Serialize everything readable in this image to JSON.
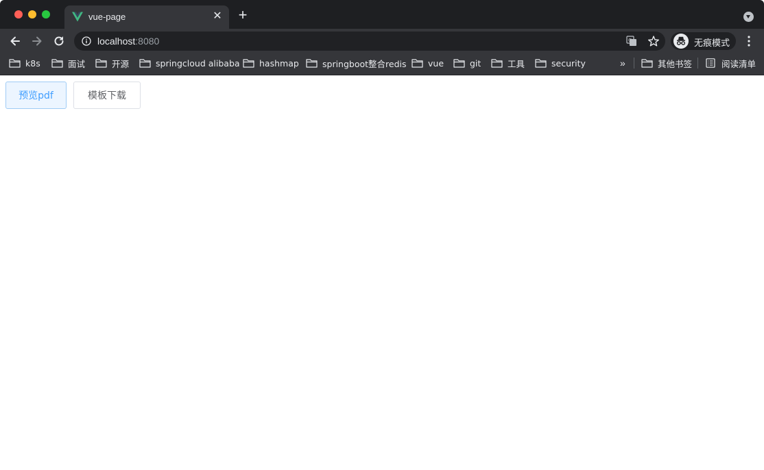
{
  "browser": {
    "tab": {
      "title": "vue-page",
      "favicon": "vue-logo-icon"
    },
    "address": {
      "host": "localhost",
      "port": ":8080"
    },
    "profile": {
      "label": "无痕模式",
      "icon": "incognito-icon"
    }
  },
  "bookmarks": {
    "items": [
      {
        "label": "k8s"
      },
      {
        "label": "面试"
      },
      {
        "label": "开源"
      },
      {
        "label": "springcloud alibaba"
      },
      {
        "label": "hashmap"
      },
      {
        "label": "springboot整合redis"
      },
      {
        "label": "vue"
      },
      {
        "label": "git"
      },
      {
        "label": "工具"
      },
      {
        "label": "security"
      }
    ],
    "overflow": "»",
    "other": "其他书签",
    "reading_list": "阅读清单"
  },
  "page": {
    "preview_button": "预览pdf",
    "download_button": "模板下载"
  },
  "colors": {
    "primary": "#409eff",
    "primary_light_bg": "#ecf5ff",
    "default_text": "#606266"
  }
}
